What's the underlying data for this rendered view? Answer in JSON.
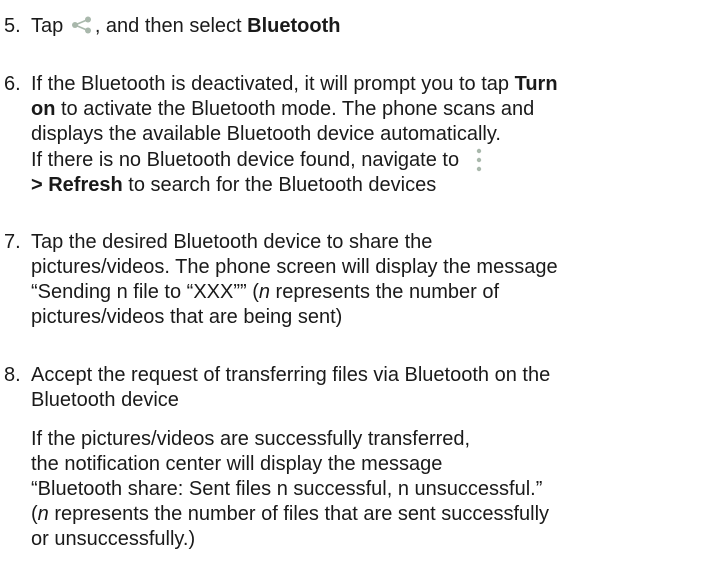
{
  "steps": [
    {
      "number": "5.",
      "text_before_icon": "Tap ",
      "icon": "share-icon",
      "text_after_icon": ", and then select ",
      "bold": "Bluetooth"
    },
    {
      "number": "6.",
      "l1_text": "If the Bluetooth is deactivated, it will prompt you to tap ",
      "l1_bold": "Turn",
      "l2_bold": "on",
      "l2_text": " to activate the Bluetooth mode. The phone scans and",
      "l3_text": "displays the available Bluetooth device automatically.",
      "l4_text": "If there is no Bluetooth device found, navigate to",
      "l4_icon": "more-options-icon",
      "l5_bold": "> Refresh",
      "l5_text": " to search for the Bluetooth devices"
    },
    {
      "number": "7.",
      "l1_text": "Tap the desired Bluetooth device to share the",
      "l2_text": "pictures/videos. The phone screen will display the message",
      "l3_text": "“Sending n file to “XXX”” (",
      "l3_italic": "n",
      "l3_text_after": " represents the number of",
      "l4_text": "pictures/videos that are being sent)"
    },
    {
      "number": "8.",
      "l1_text": "Accept the request of transferring files via Bluetooth on the",
      "l2_text": "Bluetooth device",
      "p2_l1": "If the pictures/videos are successfully transferred,",
      "p2_l2": "the notification center will display the message",
      "p2_l3": "“Bluetooth share: Sent files n successful, n unsuccessful.”",
      "p2_l4_open": "(",
      "p2_l4_italic": "n",
      "p2_l4_text": " represents the number of files that are sent successfully",
      "p2_l5": "or unsuccessfully.)"
    }
  ],
  "colors": {
    "text": "#1a1a1a",
    "icon": "#a9b8ac"
  }
}
